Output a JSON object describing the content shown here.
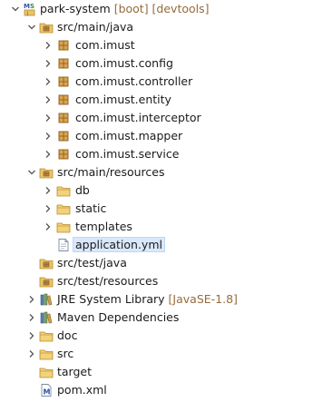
{
  "project": {
    "name": "park-system",
    "decorations": "[boot] [devtools]",
    "icon": "maven-spring-project-icon"
  },
  "src_main_java": {
    "label": "src/main/java",
    "packages": [
      "com.imust",
      "com.imust.config",
      "com.imust.controller",
      "com.imust.entity",
      "com.imust.interceptor",
      "com.imust.mapper",
      "com.imust.service"
    ]
  },
  "src_main_resources": {
    "label": "src/main/resources",
    "folders": [
      "db",
      "static",
      "templates"
    ],
    "file": "application.yml"
  },
  "src_test_java": {
    "label": "src/test/java"
  },
  "src_test_resources": {
    "label": "src/test/resources"
  },
  "jre": {
    "label": "JRE System Library",
    "decoration": "[JavaSE-1.8]"
  },
  "maven": {
    "label": "Maven Dependencies"
  },
  "doc": {
    "label": "doc"
  },
  "src": {
    "label": "src"
  },
  "target": {
    "label": "target"
  },
  "pom": {
    "label": "pom.xml"
  },
  "colors": {
    "decoration": "#956c3b",
    "selection": "#d9e8fb",
    "folder": "#e8c66a",
    "package": "#c08a3a"
  }
}
